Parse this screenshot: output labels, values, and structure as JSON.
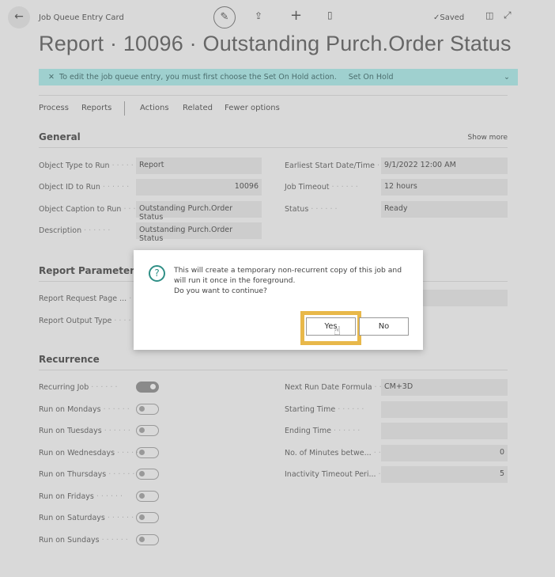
{
  "header": {
    "breadcrumb": "Job Queue Entry Card",
    "saved": "✓Saved",
    "title": "Report · 10096 · Outstanding Purch.Order Status"
  },
  "banner": {
    "message": "To edit the job queue entry, you must first choose the Set On Hold action.",
    "action": "Set On Hold"
  },
  "menu": [
    "Process",
    "Reports",
    "Actions",
    "Related",
    "Fewer options"
  ],
  "general": {
    "title": "General",
    "show_more": "Show more",
    "left": [
      {
        "label": "Object Type to Run",
        "value": "Report"
      },
      {
        "label": "Object ID to Run",
        "value": "10096"
      },
      {
        "label": "Object Caption to Run",
        "value": "Outstanding Purch.Order Status"
      },
      {
        "label": "Description",
        "value": "Outstanding Purch.Order Status"
      }
    ],
    "right": [
      {
        "label": "Earliest Start Date/Time",
        "value": "9/1/2022 12:00 AM"
      },
      {
        "label": "Job Timeout",
        "value": "12 hours"
      },
      {
        "label": "Status",
        "value": "Ready"
      }
    ]
  },
  "report_params": {
    "title": "Report Parameters",
    "rows": [
      "Report Request Page ...",
      "Report Output Type"
    ]
  },
  "recurrence": {
    "title": "Recurrence",
    "toggles": [
      {
        "label": "Recurring Job",
        "on": true
      },
      {
        "label": "Run on Mondays",
        "on": false
      },
      {
        "label": "Run on Tuesdays",
        "on": false
      },
      {
        "label": "Run on Wednesdays",
        "on": false
      },
      {
        "label": "Run on Thursdays",
        "on": false
      },
      {
        "label": "Run on Fridays",
        "on": false
      },
      {
        "label": "Run on Saturdays",
        "on": false
      },
      {
        "label": "Run on Sundays",
        "on": false
      }
    ],
    "right": [
      {
        "label": "Next Run Date Formula",
        "value": "CM+3D"
      },
      {
        "label": "Starting Time",
        "value": ""
      },
      {
        "label": "Ending Time",
        "value": ""
      },
      {
        "label": "No. of Minutes betwe...",
        "value": "0"
      },
      {
        "label": "Inactivity Timeout Peri...",
        "value": "5"
      }
    ]
  },
  "dialog": {
    "line1": "This will create a temporary non-recurrent copy of this job and",
    "line2": "will run it once in the foreground.",
    "line3": "Do you want to continue?",
    "yes": "Yes",
    "no": "No",
    "highlight_color": "#e8b84a"
  }
}
